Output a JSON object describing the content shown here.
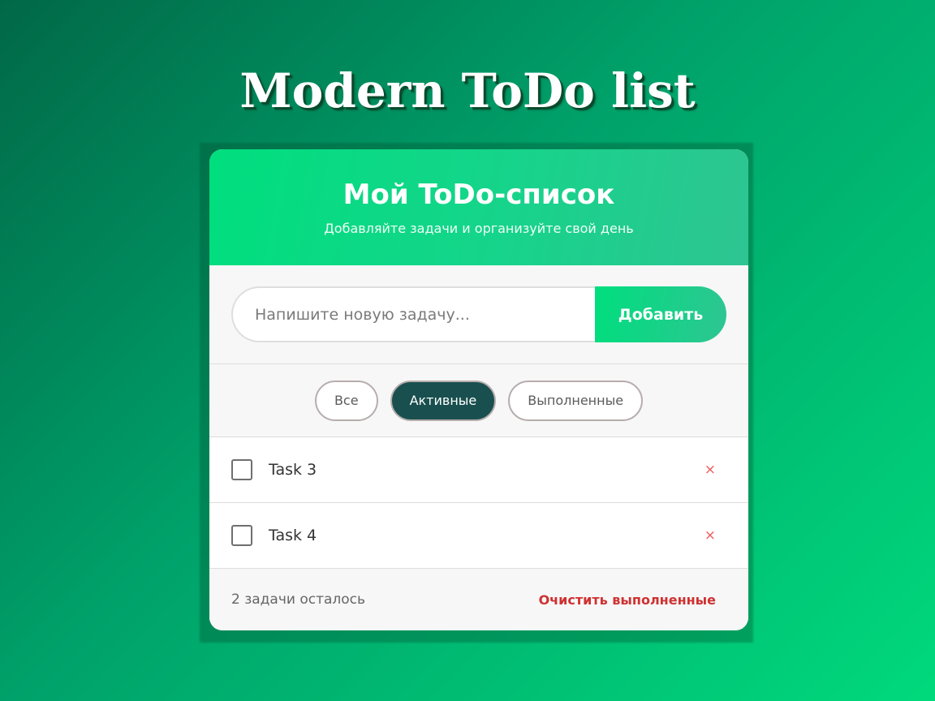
{
  "page": {
    "title": "Modern ToDo list"
  },
  "card": {
    "title": "Мой ToDo-список",
    "subtitle": "Добавляйте задачи и организуйте свой день"
  },
  "input": {
    "placeholder": "Напишите новую задачу...",
    "value": "",
    "add_label": "Добавить"
  },
  "filters": [
    {
      "label": "Все",
      "active": false
    },
    {
      "label": "Активные",
      "active": true
    },
    {
      "label": "Выполненные",
      "active": false
    }
  ],
  "tasks": [
    {
      "text": "Task 3",
      "done": false,
      "delete_symbol": "×"
    },
    {
      "text": "Task 4",
      "done": false,
      "delete_symbol": "×"
    }
  ],
  "footer": {
    "count_text": "2 задачи осталось",
    "clear_label": "Очистить выполненные"
  },
  "colors": {
    "accent": "#00de7e",
    "active_filter": "#19504f",
    "danger": "#cf3131"
  },
  "icons": {
    "checkbox": "checkbox-icon",
    "delete": "close-icon"
  }
}
